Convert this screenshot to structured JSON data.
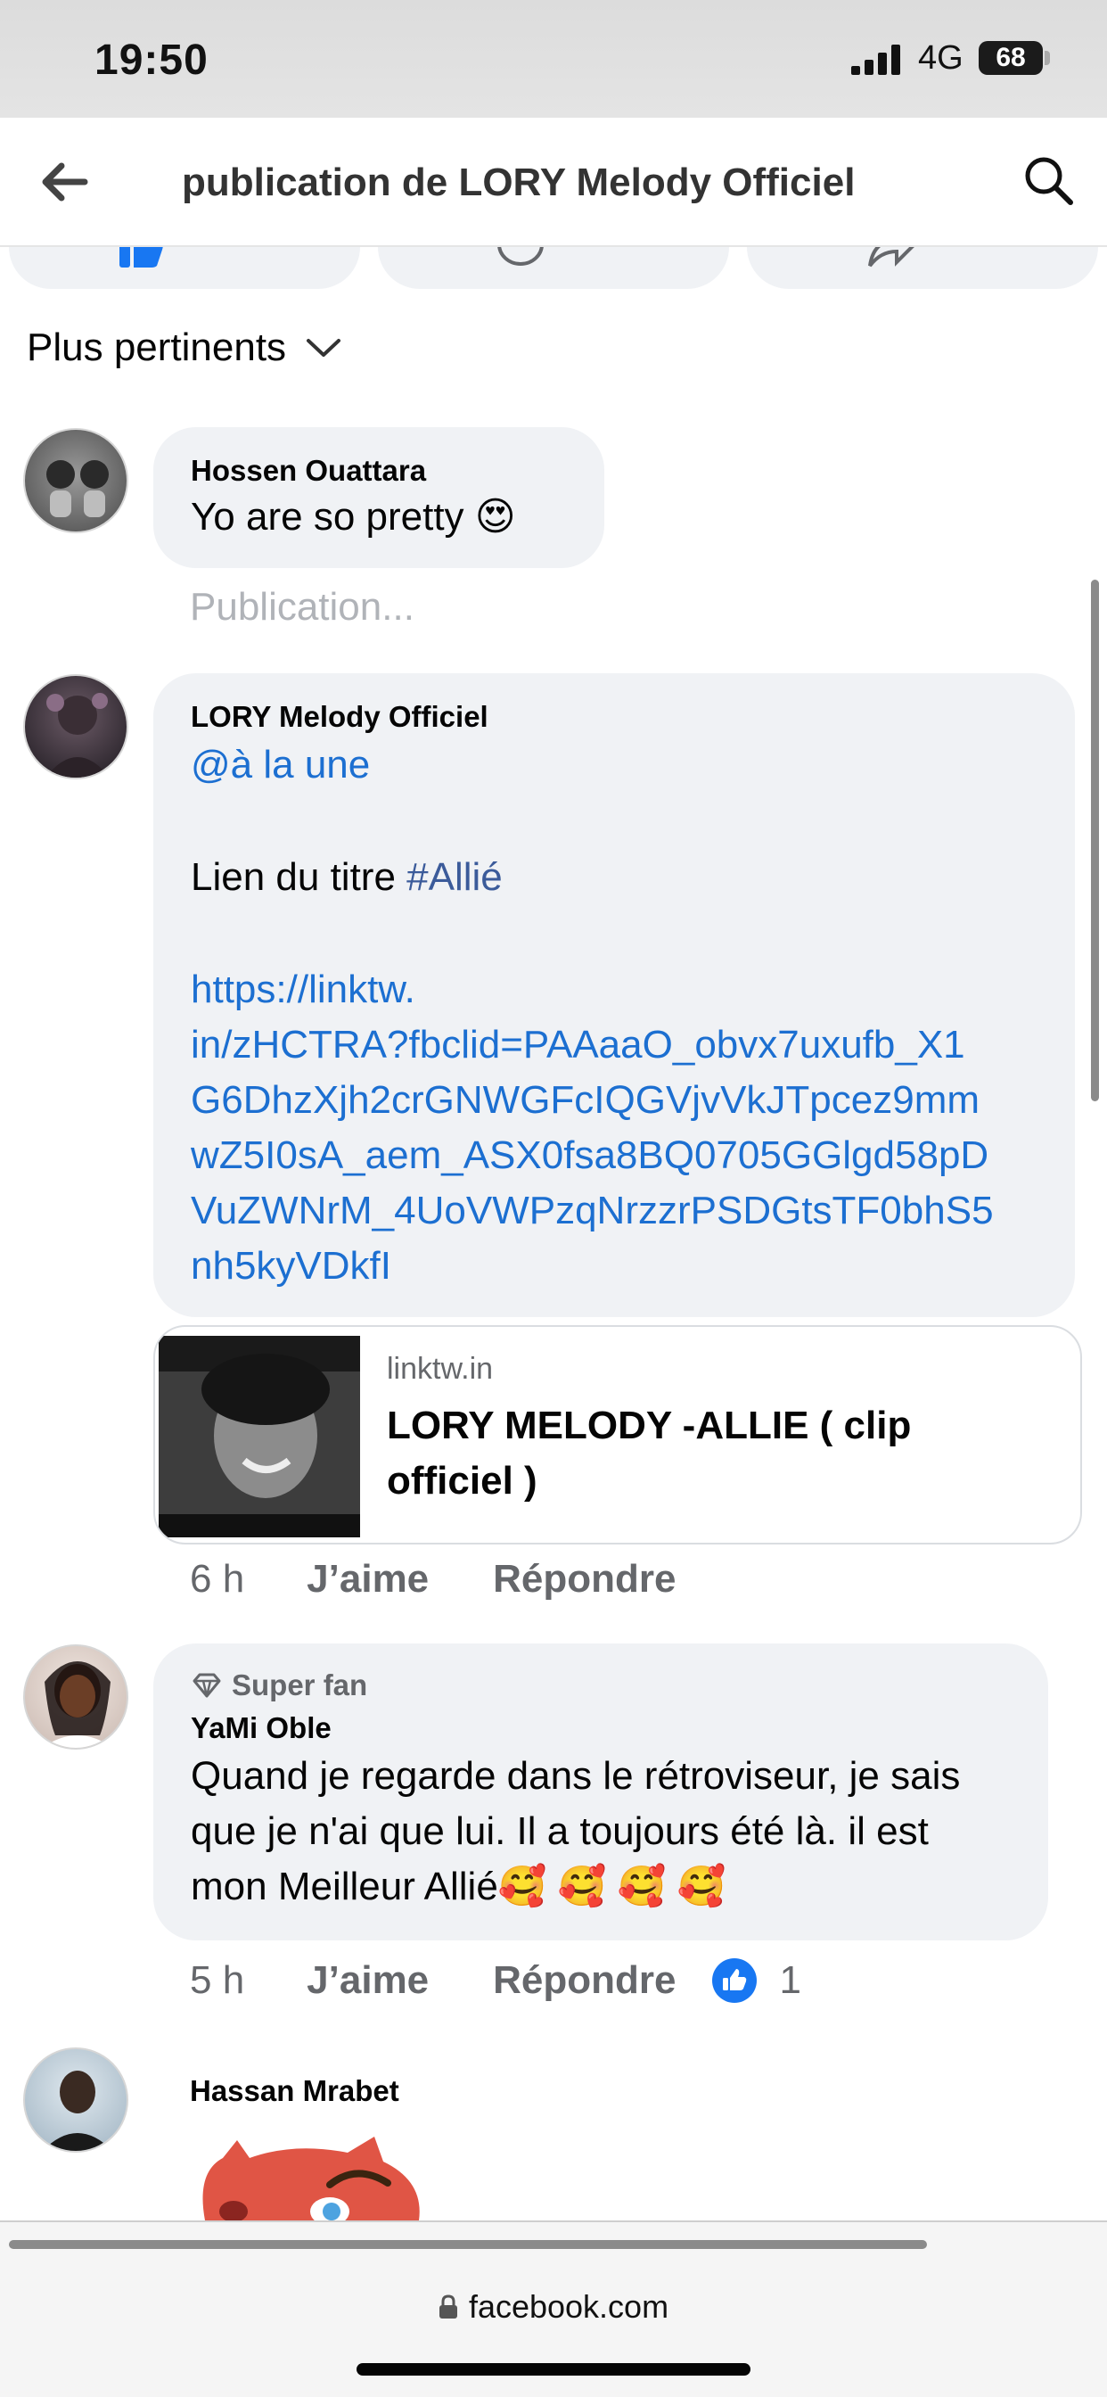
{
  "status": {
    "time": "19:50",
    "network": "4G",
    "battery": "68"
  },
  "nav": {
    "title": "publication de LORY Melody Officiel"
  },
  "sort": {
    "label": "Plus pertinents"
  },
  "comments": [
    {
      "author": "Hossen Ouattara",
      "text": "Yo are so pretty",
      "emoji": "😍",
      "pending": "Publication..."
    },
    {
      "author": "LORY Melody Officiel",
      "mention": "@à la une",
      "line_prefix": "Lien du titre ",
      "hashtag": "#Allié",
      "url_lines": [
        "https://linktw.",
        "in/zHCTRA?fbclid=PAAaaO_obvx7uxufb_X1",
        "G6DhzXjh2crGNWGFcIQGVjvVkJTpcez9mm",
        "wZ5I0sA_aem_ASX0fsa8BQ0705GGlgd58pD",
        "VuZWNrM_4UoVWPzqNrzzrPSDGtsTF0bhS5",
        "nh5kyVDkfI"
      ],
      "preview": {
        "domain": "linktw.in",
        "title": "LORY MELODY -ALLIE ( clip officiel )"
      },
      "time": "6 h",
      "like_label": "J’aime",
      "reply_label": "Répondre"
    },
    {
      "badge": "Super fan",
      "author": "YaMi Oble",
      "text_lines": [
        "Quand je regarde dans le rétroviseur, je sais",
        "que je n'ai que lui. Il a toujours été là. il est",
        "mon Meilleur Allié🥰 🥰 🥰 🥰"
      ],
      "time": "5 h",
      "like_label": "J’aime",
      "reply_label": "Répondre",
      "reaction_count": "1"
    },
    {
      "author": "Hassan Mrabet"
    }
  ],
  "browser": {
    "url": "facebook.com"
  },
  "colors": {
    "link": "#1c6fd1",
    "like_blue": "#1877f2",
    "bubble": "#f0f2f5",
    "meta_gray": "#65676b"
  }
}
